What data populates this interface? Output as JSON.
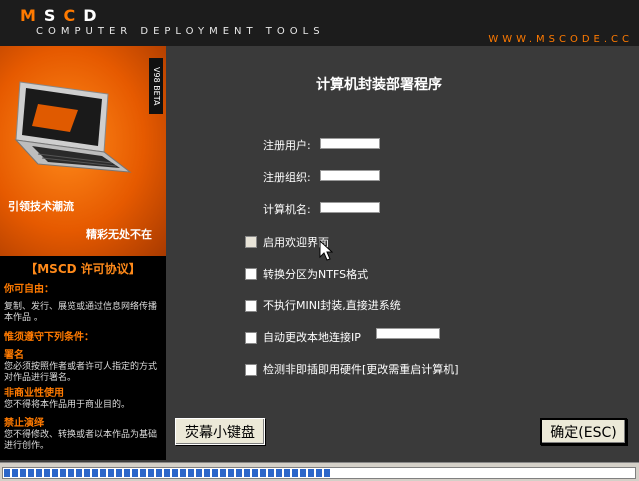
{
  "header": {
    "logo_letters": [
      "M",
      "S",
      "C",
      "D"
    ],
    "tagline": "COMPUTER DEPLOYMENT TOOLS",
    "url": "WWW.MSCODE.CC"
  },
  "promo": {
    "version_badge": "V98 BETA",
    "line1": "引领技术潮流",
    "line2": "精彩无处不在"
  },
  "license": {
    "title": "【MSCD 许可协议】",
    "sections": [
      {
        "heading": "你可自由：",
        "text": "复制、发行、展览或通过信息网络传播本作品 。"
      },
      {
        "heading": "惟须遵守下列条件：",
        "text": ""
      },
      {
        "heading": "署名",
        "text": "您必须按照作者或者许可人指定的方式对作品进行署名。"
      },
      {
        "heading": "非商业性使用",
        "text": "您不得将本作品用于商业目的。"
      },
      {
        "heading": "禁止演绎",
        "text": "您不得修改、转换或者以本作品为基础进行创作。"
      }
    ]
  },
  "main": {
    "title": "计算机封装部署程序",
    "fields": [
      {
        "label": "注册用户:",
        "value": ""
      },
      {
        "label": "注册组织:",
        "value": ""
      },
      {
        "label": "计算机名:",
        "value": ""
      }
    ],
    "options": [
      {
        "label": "启用欢迎界面",
        "checked": false
      },
      {
        "label": "转换分区为NTFS格式",
        "checked": false
      },
      {
        "label": "不执行MINI封装,直接进系统",
        "checked": false
      },
      {
        "label": "自动更改本地连接IP",
        "checked": false
      },
      {
        "label": "检测非即插即用硬件[更改需重启计算机]",
        "checked": false
      }
    ],
    "ip_value": ""
  },
  "buttons": {
    "keyboard": "荧幕小键盘",
    "ok": "确定(ESC)"
  },
  "progress": {
    "fraction": 0.53
  },
  "colors": {
    "accent": "#ff7a00",
    "background": "#3a3a3a",
    "header": "#1c1c1c",
    "progress": "#2b66c9"
  }
}
